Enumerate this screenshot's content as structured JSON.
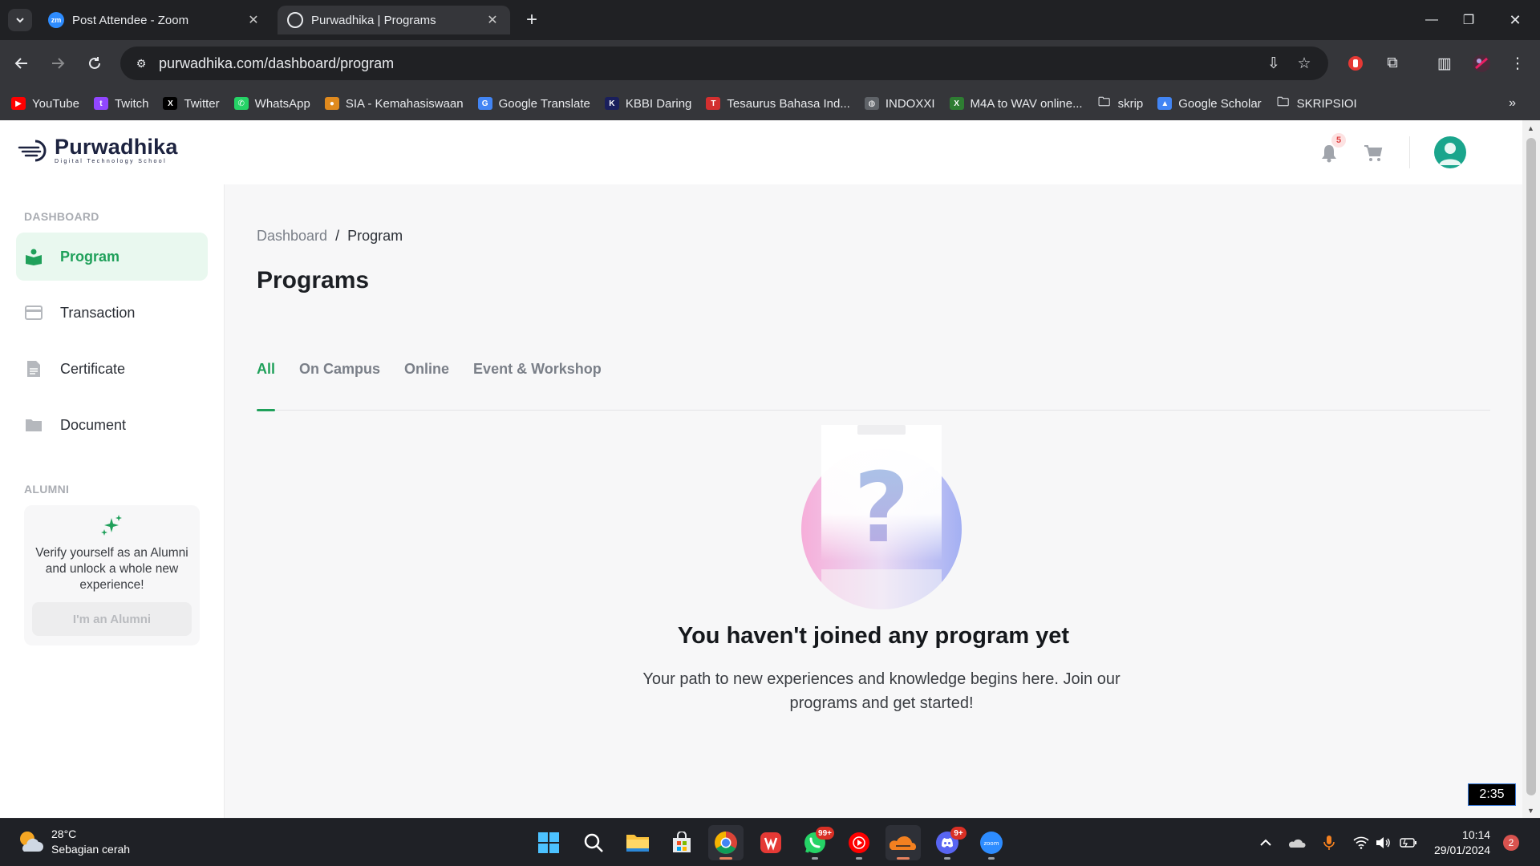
{
  "browser": {
    "tabs": [
      {
        "title": "Post Attendee - Zoom",
        "favicon_text": "zm",
        "active": false
      },
      {
        "title": "Purwadhika | Programs",
        "active": true
      }
    ],
    "url": "purwadhika.com/dashboard/program",
    "bookmarks": [
      {
        "label": "YouTube",
        "icon": "youtube-icon",
        "color": "#ff0000",
        "glyph": "▶"
      },
      {
        "label": "Twitch",
        "icon": "twitch-icon",
        "color": "#9146ff",
        "glyph": "t"
      },
      {
        "label": "Twitter",
        "icon": "x-icon",
        "color": "#000000",
        "glyph": "X"
      },
      {
        "label": "WhatsApp",
        "icon": "whatsapp-icon",
        "color": "#25d366",
        "glyph": "✆"
      },
      {
        "label": "SIA - Kemahasiswaan",
        "icon": "sia-icon",
        "color": "#e08a1e",
        "glyph": "●"
      },
      {
        "label": "Google Translate",
        "icon": "google-translate-icon",
        "color": "#4285f4",
        "glyph": "G"
      },
      {
        "label": "KBBI Daring",
        "icon": "kbbi-icon",
        "color": "#1a1f5c",
        "glyph": "K"
      },
      {
        "label": "Tesaurus Bahasa Ind...",
        "icon": "tesaurus-icon",
        "color": "#d32f2f",
        "glyph": "T"
      },
      {
        "label": "INDOXXI",
        "icon": "globe-icon",
        "color": "#5f6368",
        "glyph": "◍"
      },
      {
        "label": "M4A to WAV online...",
        "icon": "converter-icon",
        "color": "#2e7d32",
        "glyph": "X"
      },
      {
        "label": "skrip",
        "icon": "folder-icon",
        "color": "transparent",
        "glyph": "🗀"
      },
      {
        "label": "Google Scholar",
        "icon": "google-scholar-icon",
        "color": "#4285f4",
        "glyph": "▲"
      },
      {
        "label": "SKRIPSIOI",
        "icon": "folder-icon",
        "color": "transparent",
        "glyph": "🗀"
      }
    ]
  },
  "site": {
    "logo_name": "Purwadhika",
    "logo_tag": "Digital Technology School",
    "notification_count": "5"
  },
  "sidebar": {
    "section_dashboard": "DASHBOARD",
    "items": [
      {
        "label": "Program",
        "icon": "book-reader-icon",
        "active": true
      },
      {
        "label": "Transaction",
        "icon": "credit-card-icon",
        "active": false
      },
      {
        "label": "Certificate",
        "icon": "document-icon",
        "active": false
      },
      {
        "label": "Document",
        "icon": "folder-icon",
        "active": false
      }
    ],
    "section_alumni": "ALUMNI",
    "alumni_text": "Verify yourself as an Alumni and unlock a whole new experience!",
    "alumni_button": "I'm an Alumni"
  },
  "main": {
    "breadcrumb": {
      "root": "Dashboard",
      "separator": "/",
      "current": "Program"
    },
    "title": "Programs",
    "tabs": [
      {
        "label": "All",
        "active": true
      },
      {
        "label": "On Campus",
        "active": false
      },
      {
        "label": "Online",
        "active": false
      },
      {
        "label": "Event & Workshop",
        "active": false
      }
    ],
    "empty_title": "You haven't joined any program yet",
    "empty_desc": "Your path to new experiences and knowledge begins here. Join our programs and get started!"
  },
  "video_timer": "2:35",
  "taskbar": {
    "weather_temp": "28°C",
    "weather_desc": "Sebagian cerah",
    "whatsapp_badge": "99+",
    "discord_badge": "9+",
    "time": "10:14",
    "date": "29/01/2024",
    "notification_count": "2"
  },
  "colors": {
    "accent": "#1fa05a",
    "accent_bg": "#e9f8ef",
    "avatar": "#1aa58c"
  }
}
